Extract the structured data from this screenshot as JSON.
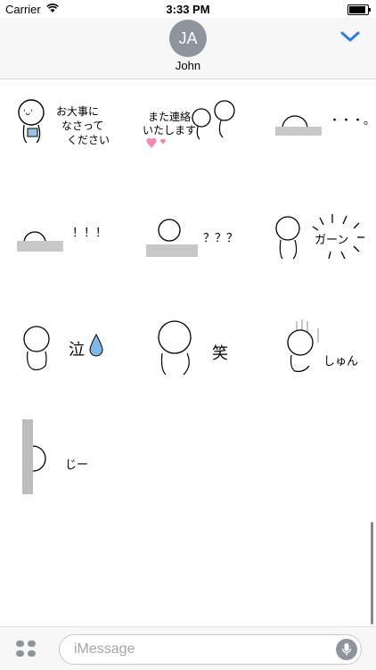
{
  "status_bar": {
    "carrier": "Carrier",
    "time": "3:33 PM",
    "battery_level": 0.9
  },
  "header": {
    "avatar_initials": "JA",
    "contact_name": "John"
  },
  "stickers": [
    {
      "lines": [
        "お大事に",
        "なさって",
        "ください"
      ]
    },
    {
      "lines": [
        "また連絡",
        "いたします"
      ]
    },
    {
      "text": "・・・。"
    },
    {
      "text": "！！！"
    },
    {
      "text": "？？？"
    },
    {
      "text": "ガーン"
    },
    {
      "text": "泣"
    },
    {
      "text": "笑"
    },
    {
      "text": "しゅん"
    },
    {
      "text": "じー"
    }
  ],
  "input": {
    "placeholder": "iMessage"
  },
  "colors": {
    "accent": "#2f7de1",
    "avatar": "#8e949e",
    "heart": "#f28aa8",
    "tear": "#7fb8e6"
  },
  "icons": {
    "wifi": "wifi-icon",
    "battery": "battery-icon",
    "chevron": "chevron-down-icon",
    "apps": "app-drawer-icon",
    "mic": "microphone-icon"
  }
}
